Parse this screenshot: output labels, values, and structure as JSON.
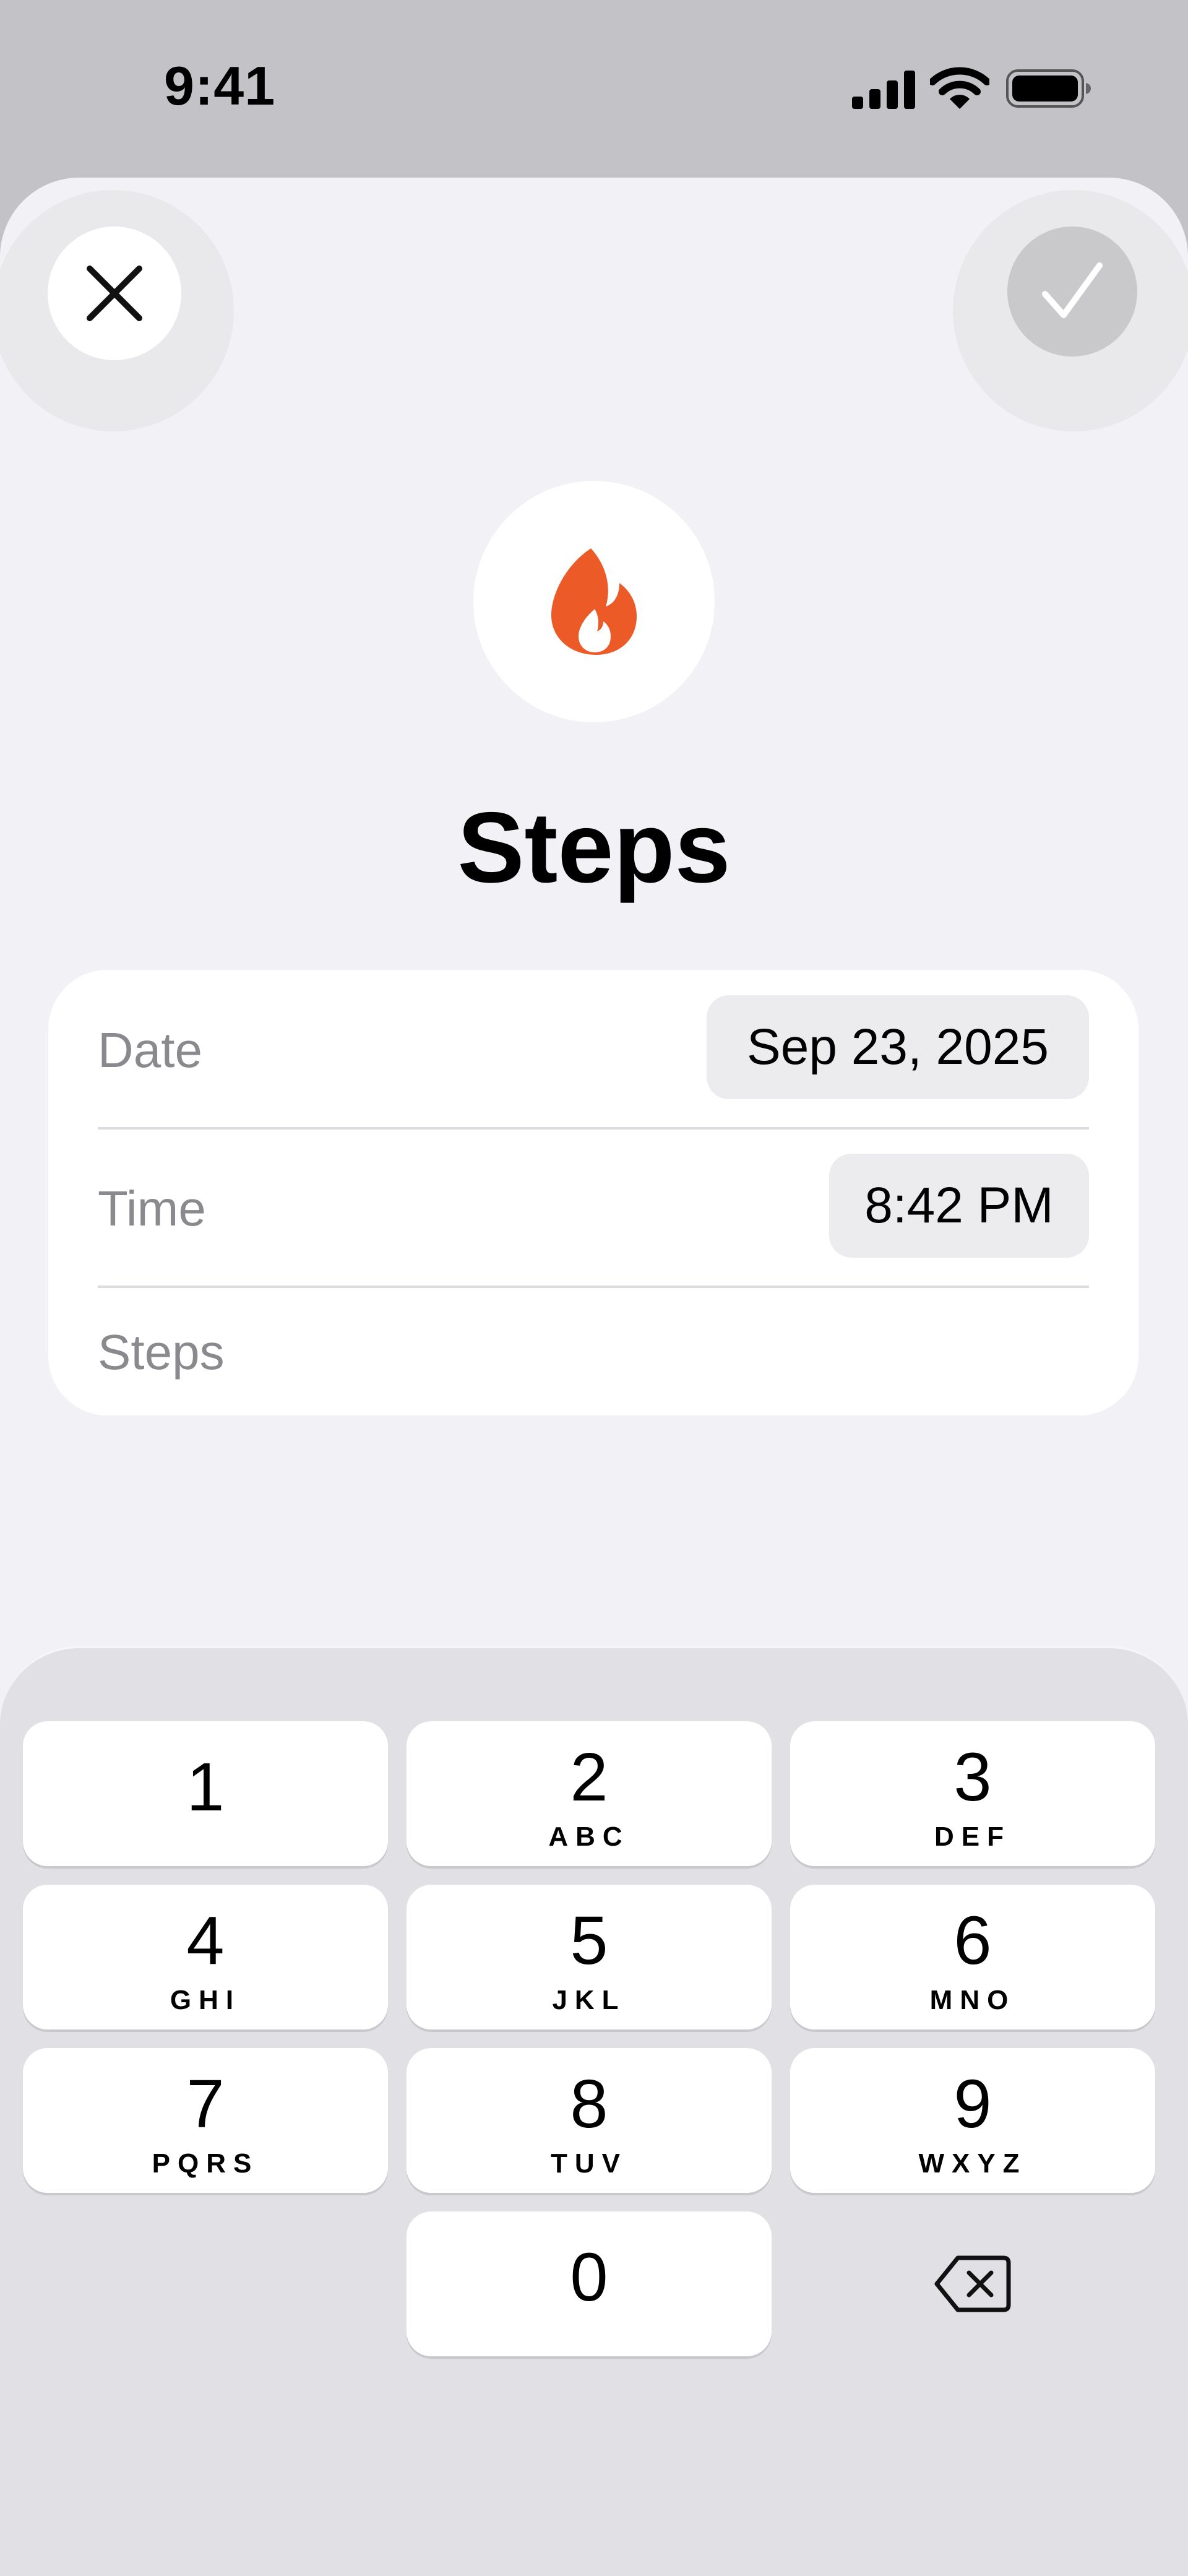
{
  "status_bar": {
    "time": "9:41",
    "icons": [
      "cellular-signal-icon",
      "wifi-icon",
      "battery-icon"
    ]
  },
  "toolbar": {
    "close_icon": "close-icon",
    "confirm_icon": "checkmark-icon"
  },
  "header": {
    "icon": "flame-icon",
    "icon_color": "#ec5a28",
    "title": "Steps"
  },
  "form": {
    "date": {
      "label": "Date",
      "value": "Sep 23, 2025"
    },
    "time": {
      "label": "Time",
      "value": "8:42 PM"
    },
    "steps": {
      "label": "Steps",
      "value": ""
    }
  },
  "keypad": {
    "keys": [
      {
        "num": "1",
        "letters": ""
      },
      {
        "num": "2",
        "letters": "ABC"
      },
      {
        "num": "3",
        "letters": "DEF"
      },
      {
        "num": "4",
        "letters": "GHI"
      },
      {
        "num": "5",
        "letters": "JKL"
      },
      {
        "num": "6",
        "letters": "MNO"
      },
      {
        "num": "7",
        "letters": "PQRS"
      },
      {
        "num": "8",
        "letters": "TUV"
      },
      {
        "num": "9",
        "letters": "WXYZ"
      },
      {
        "num": "0",
        "letters": ""
      }
    ],
    "backspace_icon": "backspace-icon"
  }
}
